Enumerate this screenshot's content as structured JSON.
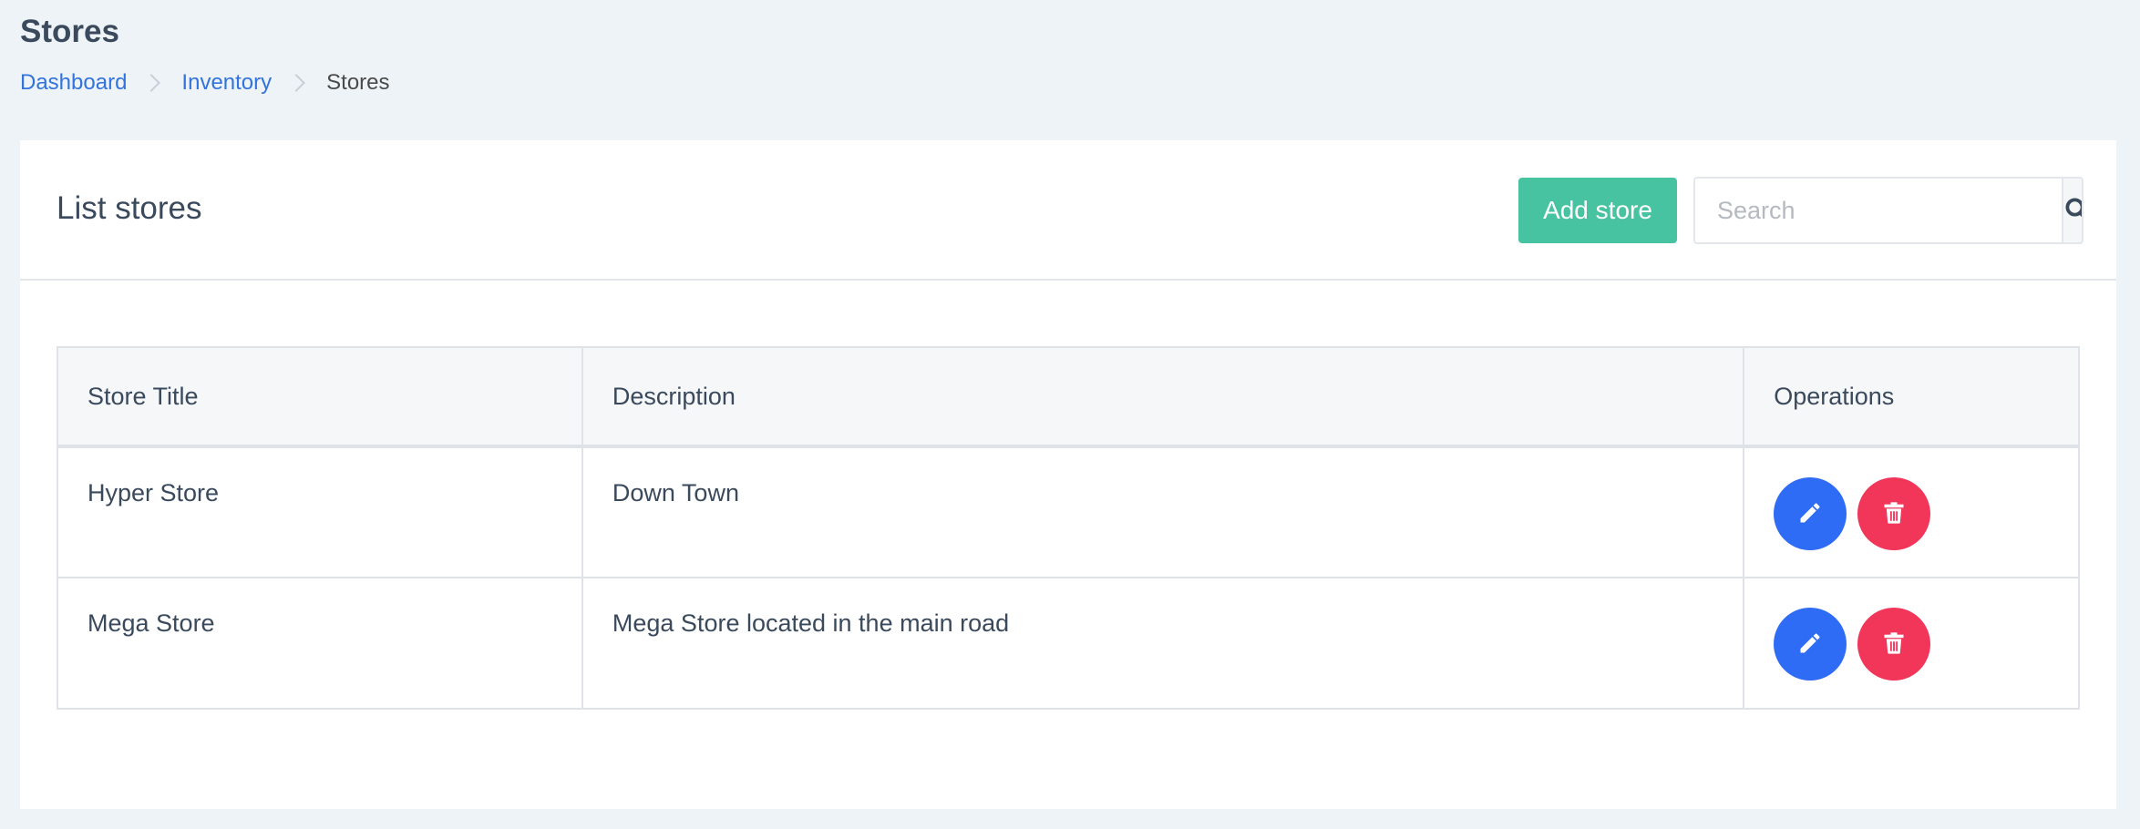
{
  "page": {
    "title": "Stores"
  },
  "breadcrumb": {
    "items": [
      "Dashboard",
      "Inventory"
    ],
    "current": "Stores"
  },
  "card": {
    "title": "List stores",
    "add_label": "Add store",
    "search_placeholder": "Search"
  },
  "table": {
    "columns": [
      "Store Title",
      "Description",
      "Operations"
    ],
    "rows": [
      {
        "title": "Hyper Store",
        "description": "Down Town"
      },
      {
        "title": "Mega Store",
        "description": "Mega Store located in the main road"
      }
    ]
  },
  "icons": {
    "search": "search-icon",
    "edit": "pencil-icon",
    "delete": "trash-icon",
    "breadcrumb_separator": "chevron-right-icon"
  },
  "colors": {
    "background": "#edf3f7",
    "link": "#3273dc",
    "add_button": "#48c3a1",
    "edit_button": "#2f6cf5",
    "delete_button": "#f1365a",
    "heading": "#3a4a5c"
  }
}
